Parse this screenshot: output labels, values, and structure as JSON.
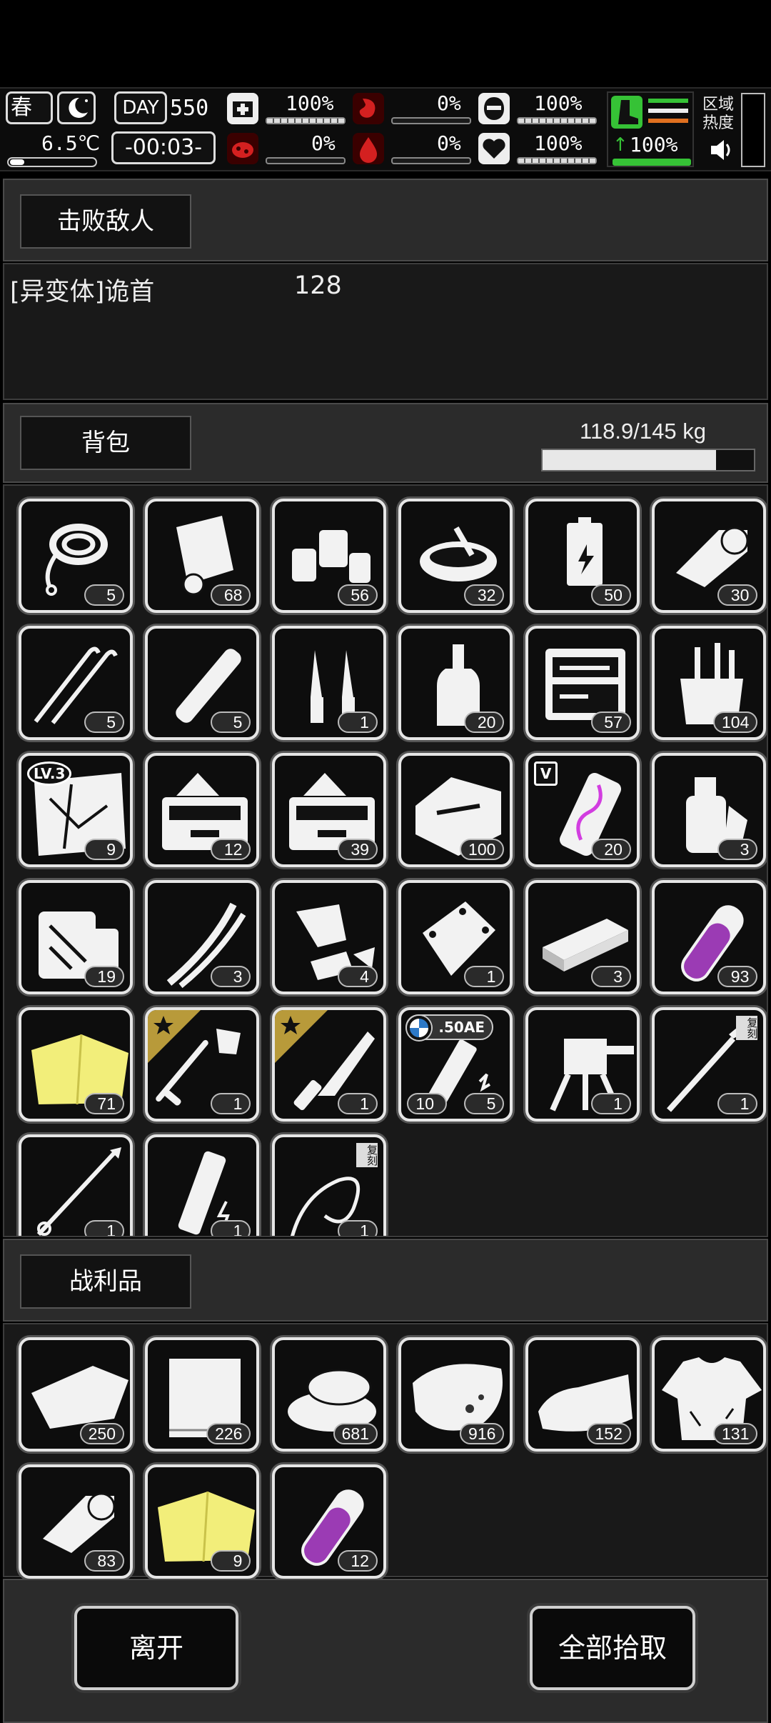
{
  "status": {
    "season": "春",
    "temperature": "6.5℃",
    "day_label": "DAY",
    "day_number": "550",
    "clock": "-00:03-",
    "health_pct": "100%",
    "hunger_pct": "0%",
    "armor_pct": "100%",
    "infection_pct": "0%",
    "bleeding_pct": "0%",
    "mood_pct": "100%",
    "stamina_pct": "100%",
    "region_heat_label": "区域\n热度",
    "health_level": 1.0,
    "hunger_level": 0.0,
    "armor_level": 1.0,
    "infection_level": 0.0,
    "bleeding_level": 0.0,
    "mood_level": 1.0,
    "stamina_level": 1.0,
    "colors": {
      "danger": "#d42020",
      "stamina": "#36c236",
      "heat_orange": "#e07020"
    }
  },
  "defeated": {
    "tab_label": "击败敌人",
    "enemy_name": "[异变体]诡首",
    "enemy_count": "128"
  },
  "backpack": {
    "tab_label": "背包",
    "weight_text": "118.9/145 kg",
    "weight_fraction": 0.82,
    "items": [
      {
        "icon": "rope-icon",
        "count": "5"
      },
      {
        "icon": "paper-scroll-icon",
        "count": "68"
      },
      {
        "icon": "pill-bottles-icon",
        "count": "56"
      },
      {
        "icon": "bowl-icon",
        "count": "32"
      },
      {
        "icon": "battery-icon",
        "count": "50"
      },
      {
        "icon": "bandage-roll-icon",
        "count": "30"
      },
      {
        "icon": "lockpick-icon",
        "count": "5"
      },
      {
        "icon": "wrapped-stick-icon",
        "count": "5"
      },
      {
        "icon": "ampoule-icon",
        "count": "1"
      },
      {
        "icon": "liquor-bottle-icon",
        "count": "20"
      },
      {
        "icon": "repair-kit-icon",
        "count": "57"
      },
      {
        "icon": "tool-bucket-icon",
        "count": "104"
      },
      {
        "icon": "map-icon",
        "count": "9",
        "badge": "LV.3"
      },
      {
        "icon": "toolbox-icon",
        "count": "12"
      },
      {
        "icon": "toolbox-icon",
        "count": "39"
      },
      {
        "icon": "tool-case-icon",
        "count": "100"
      },
      {
        "icon": "dna-sample-icon",
        "count": "20",
        "badge": "V"
      },
      {
        "icon": "spray-bottle-icon",
        "count": "3"
      },
      {
        "icon": "supply-pack-icon",
        "count": "19"
      },
      {
        "icon": "wires-icon",
        "count": "3"
      },
      {
        "icon": "scrap-parts-icon",
        "count": "4"
      },
      {
        "icon": "metal-plate-icon",
        "count": "1"
      },
      {
        "icon": "block-icon",
        "count": "3"
      },
      {
        "icon": "test-tube-icon",
        "count": "93"
      },
      {
        "icon": "yellow-cloth-icon",
        "count": "71"
      },
      {
        "icon": "shovel-icon",
        "count": "1",
        "starred": true
      },
      {
        "icon": "knife-icon",
        "count": "1",
        "starred": true
      },
      {
        "icon": "magazine-icon",
        "count": "5",
        "left_count": "10",
        "ammo_label": ".50AE"
      },
      {
        "icon": "turret-icon",
        "count": "1"
      },
      {
        "icon": "brush-icon",
        "count": "1",
        "tag": "复刻"
      },
      {
        "icon": "spear-icon",
        "count": "1"
      },
      {
        "icon": "battery-pack-icon",
        "count": "1"
      },
      {
        "icon": "whip-icon",
        "count": "1",
        "tag": "复刻"
      }
    ]
  },
  "loot": {
    "tab_label": "战利品",
    "items": [
      {
        "icon": "cloth-icon",
        "count": "250"
      },
      {
        "icon": "fabric-sheet-icon",
        "count": "226"
      },
      {
        "icon": "folded-cloth-icon",
        "count": "681"
      },
      {
        "icon": "meat-icon",
        "count": "916"
      },
      {
        "icon": "leather-icon",
        "count": "152"
      },
      {
        "icon": "torn-shirt-icon",
        "count": "131"
      },
      {
        "icon": "bandage-roll-icon",
        "count": "83"
      },
      {
        "icon": "yellow-cloth-icon",
        "count": "9"
      },
      {
        "icon": "test-tube-icon",
        "count": "12"
      }
    ]
  },
  "actions": {
    "leave_label": "离开",
    "take_all_label": "全部拾取"
  }
}
